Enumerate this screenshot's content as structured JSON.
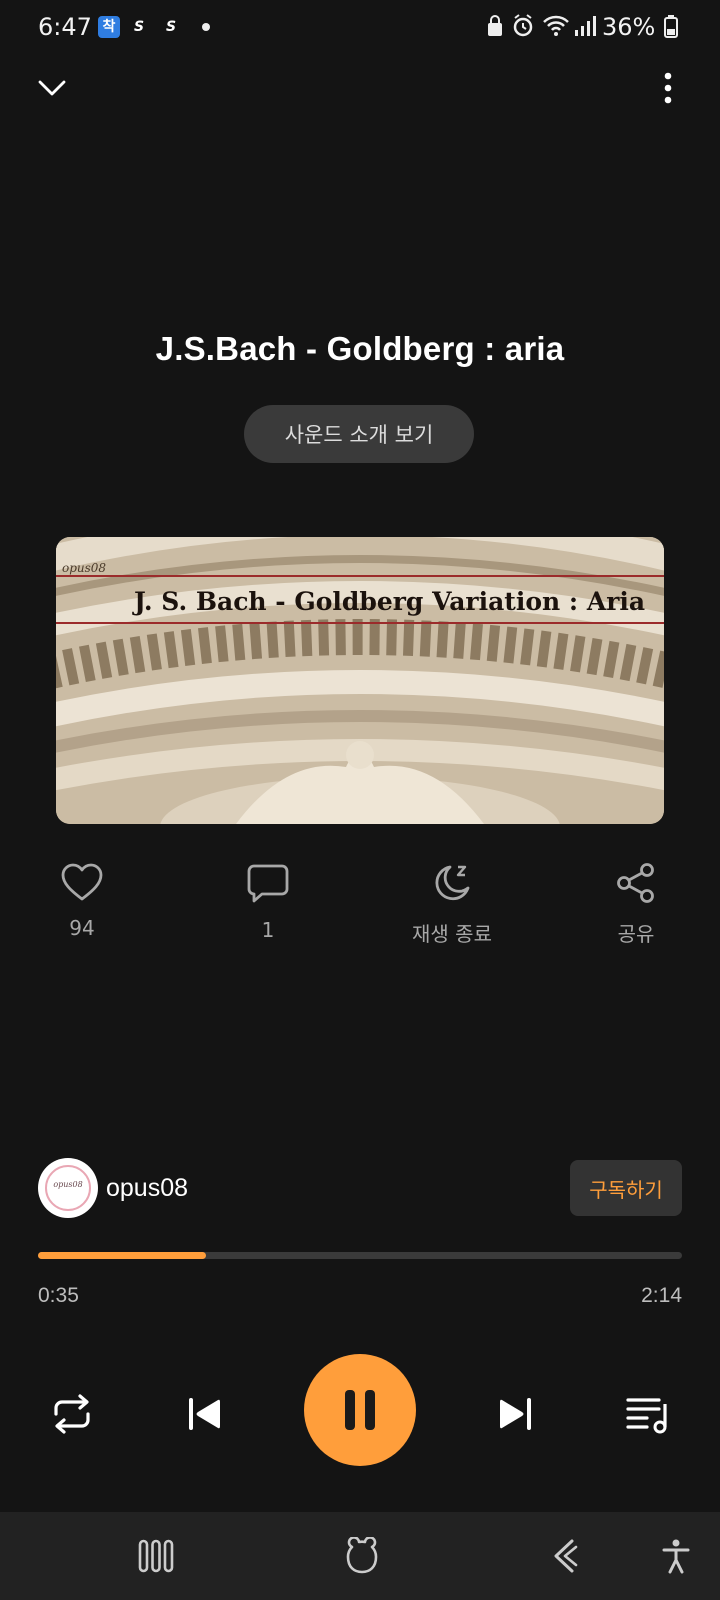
{
  "status_bar": {
    "time": "6:47",
    "battery": "36%",
    "app_badges": [
      "착",
      "S",
      "S"
    ]
  },
  "player": {
    "title": "J.S.Bach - Goldberg : aria",
    "intro_button": "사운드 소개 보기",
    "artwork": {
      "watermark": "opus08",
      "text": "J. S. Bach - Goldberg Variation : Aria"
    },
    "actions": [
      {
        "icon": "heart-icon",
        "label": "94"
      },
      {
        "icon": "comment-icon",
        "label": "1"
      },
      {
        "icon": "sleep-timer-icon",
        "label": "재생 종료"
      },
      {
        "icon": "share-icon",
        "label": "공유"
      }
    ],
    "channel": {
      "name": "opus08",
      "avatar_text": "opus08",
      "subscribe": "구독하기"
    },
    "progress": {
      "elapsed": "0:35",
      "total": "2:14",
      "fraction": 0.261
    }
  },
  "colors": {
    "accent": "#ff9e3b",
    "background": "#141414",
    "surface": "#3a3a3a",
    "nav_bar": "#222222"
  },
  "icons": {
    "collapse": "chevron-down-icon",
    "more": "more-vertical-icon",
    "repeat": "repeat-icon",
    "previous": "skip-previous-icon",
    "pause": "pause-icon",
    "next": "skip-next-icon",
    "playlist": "playlist-icon",
    "nav_recents": "recents-icon",
    "nav_home": "bixby-home-icon",
    "nav_back": "back-icon",
    "accessibility": "accessibility-icon"
  }
}
